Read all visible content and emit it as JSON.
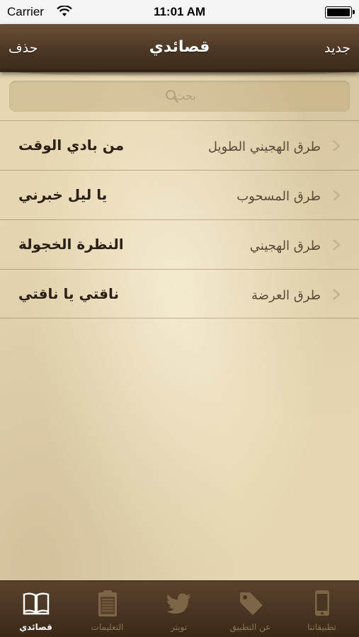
{
  "status_bar": {
    "carrier": "Carrier",
    "time": "11:01 AM"
  },
  "nav": {
    "title": "قصائدي",
    "left_button": "حذف",
    "right_button": "جديد"
  },
  "search": {
    "placeholder": "بحث"
  },
  "poems": [
    {
      "title": "من بادي الوقت",
      "tariq": "طرق الهجيني الطويل"
    },
    {
      "title": "يا ليل خبرني",
      "tariq": "طرق المسحوب"
    },
    {
      "title": "النظرة الخجولة",
      "tariq": "طرق الهجيني"
    },
    {
      "title": "ناقتي يا ناقتي",
      "tariq": "طرق العرضة"
    }
  ],
  "tabs": [
    {
      "label": "قصائدي",
      "icon": "book-icon",
      "active": true
    },
    {
      "label": "التعليمات",
      "icon": "clipboard-icon",
      "active": false
    },
    {
      "label": "تويتر",
      "icon": "twitter-bird-icon",
      "active": false
    },
    {
      "label": "عن التطبيق",
      "icon": "tag-icon",
      "active": false
    },
    {
      "label": "تطبيقاتنا",
      "icon": "phone-icon",
      "active": false
    }
  ],
  "colors": {
    "nav_bar": "#4a3522",
    "tab_bar": "#3a2816",
    "parchment": "#e6d7b2",
    "active_tab": "#ffffff",
    "inactive_tab": "#8b7456"
  }
}
